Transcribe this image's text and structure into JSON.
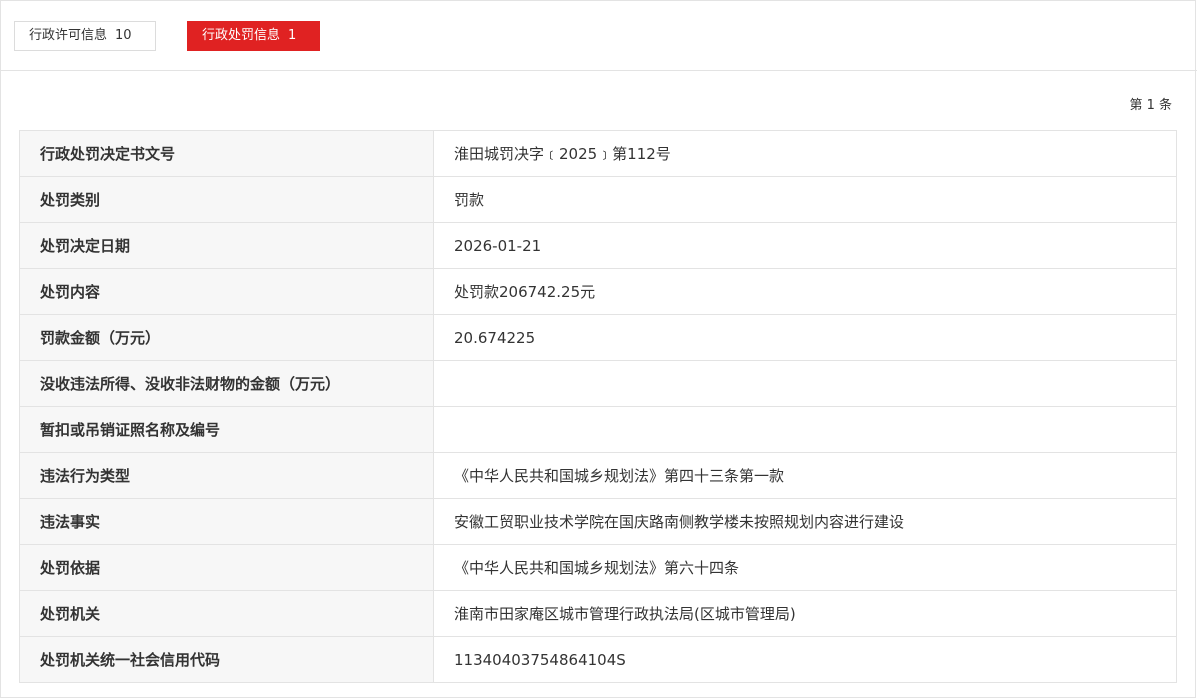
{
  "tabs": {
    "permit": {
      "label": "行政许可信息",
      "count": "10"
    },
    "penalty": {
      "label": "行政处罚信息",
      "count": "1"
    }
  },
  "pagination": {
    "record_label": "第 1 条"
  },
  "colors": {
    "accent": "#e02222",
    "border": "#e3e3e3",
    "label_bg": "#f7f7f7"
  },
  "record": {
    "rows": [
      {
        "label": "行政处罚决定书文号",
        "value": "淮田城罚决字﹝2025﹞第112号"
      },
      {
        "label": "处罚类别",
        "value": "罚款"
      },
      {
        "label": "处罚决定日期",
        "value": "2026-01-21"
      },
      {
        "label": "处罚内容",
        "value": "处罚款206742.25元"
      },
      {
        "label": "罚款金额（万元）",
        "value": "20.674225"
      },
      {
        "label": "没收违法所得、没收非法财物的金额（万元）",
        "value": ""
      },
      {
        "label": "暂扣或吊销证照名称及编号",
        "value": ""
      },
      {
        "label": "违法行为类型",
        "value": "《中华人民共和国城乡规划法》第四十三条第一款"
      },
      {
        "label": "违法事实",
        "value": "安徽工贸职业技术学院在国庆路南侧教学楼未按照规划内容进行建设"
      },
      {
        "label": "处罚依据",
        "value": "《中华人民共和国城乡规划法》第六十四条"
      },
      {
        "label": "处罚机关",
        "value": "淮南市田家庵区城市管理行政执法局(区城市管理局)"
      },
      {
        "label": "处罚机关统一社会信用代码",
        "value": "11340403754864104S"
      }
    ]
  }
}
